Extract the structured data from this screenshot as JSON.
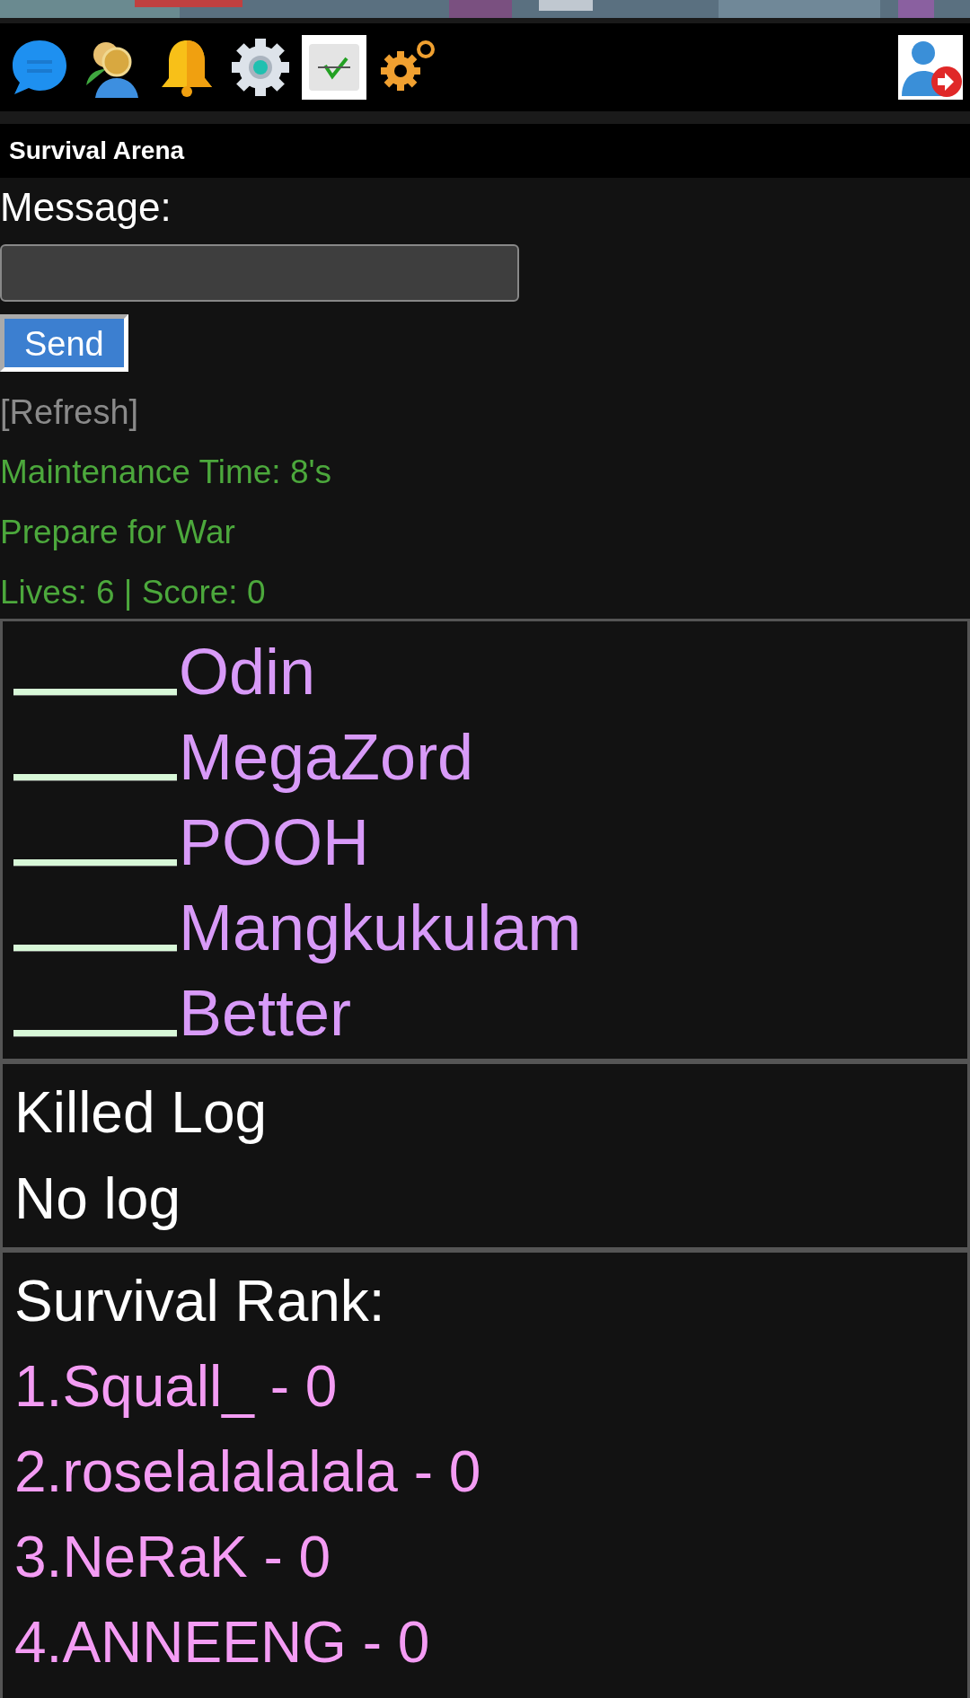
{
  "banner": {
    "kind": "picture"
  },
  "title": "Survival Arena",
  "message": {
    "label": "Message:",
    "send": "Send"
  },
  "refresh": "[Refresh]",
  "status": [
    "Maintenance Time: 8's",
    "Prepare for War",
    "Lives: 6 | Score: 0"
  ],
  "players": [
    {
      "name": "Odin",
      "level": 1
    },
    {
      "name": "MegaZord",
      "level": 1
    },
    {
      "name": "POOH",
      "level": 1
    },
    {
      "name": "Mangkukulam",
      "level": 1
    },
    {
      "name": "Better",
      "level": 1
    }
  ],
  "killed_log": {
    "title": "Killed Log",
    "entries": [
      "No log"
    ]
  },
  "rank": {
    "title": "Survival Rank:",
    "entries": [
      "1.Squall_ - 0",
      "2.roselalalalala - 0",
      "3.NeRaK - 0",
      "4.ANNEENG - 0"
    ]
  }
}
